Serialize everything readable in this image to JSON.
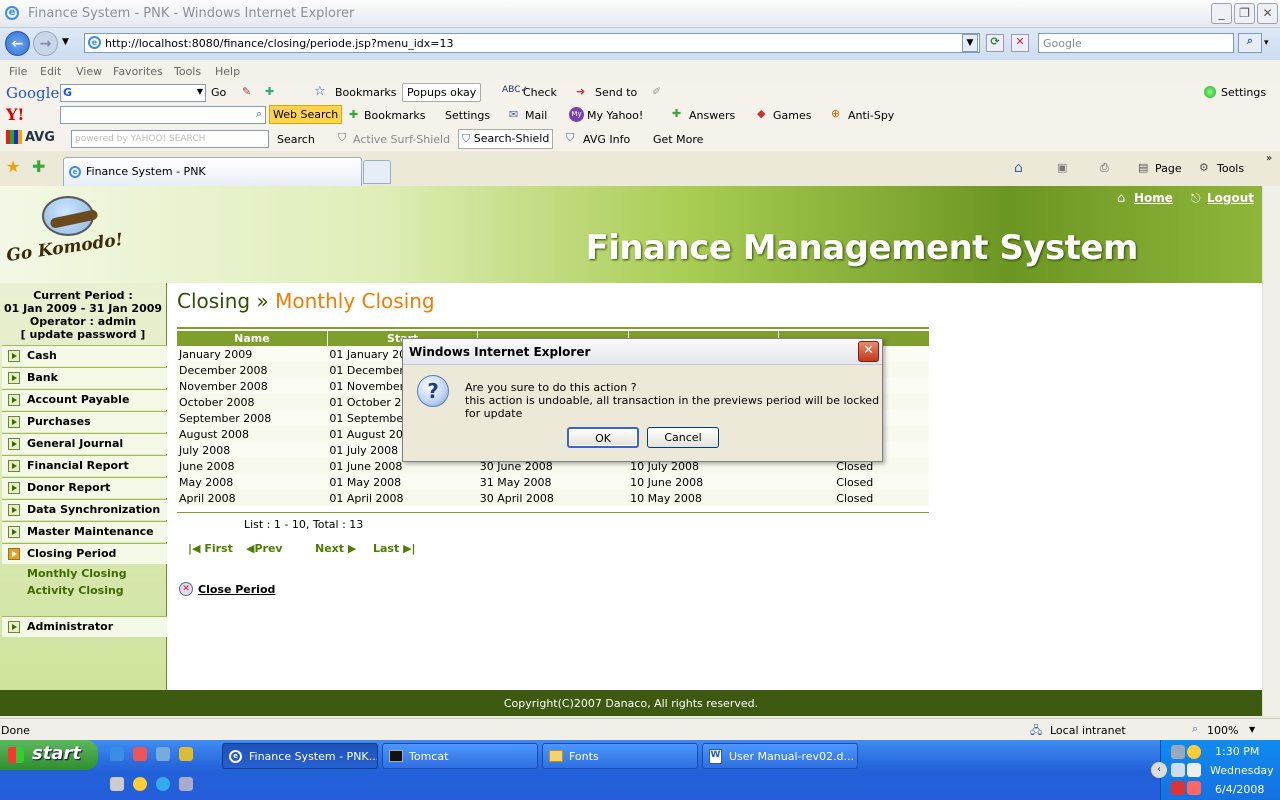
{
  "window": {
    "title": "Finance System - PNK - Windows Internet Explorer"
  },
  "address": {
    "url": "http://localhost:8080/finance/closing/periode.jsp?menu_idx=13",
    "search_placeholder": "Google"
  },
  "menu": [
    "File",
    "Edit",
    "View",
    "Favorites",
    "Tools",
    "Help"
  ],
  "google_bar": {
    "logo": "Google",
    "go": "Go",
    "bookmarks": "Bookmarks",
    "popups": "Popups okay",
    "check": "Check",
    "send_to": "Send to",
    "settings": "Settings"
  },
  "yahoo_bar": {
    "web_search": "Web Search",
    "bookmarks": "Bookmarks",
    "settings": "Settings",
    "mail": "Mail",
    "my_yahoo": "My Yahoo!",
    "answers": "Answers",
    "games": "Games",
    "anti_spy": "Anti-Spy"
  },
  "avg_bar": {
    "logo": "AVG",
    "placeholder": "powered by YAHOO! SEARCH",
    "search": "Search",
    "active_surf": "Active  Surf-Shield",
    "search_shield": "Search-Shield",
    "avg_info": "AVG Info",
    "get_more": "Get More"
  },
  "tab": {
    "label": "Finance System - PNK",
    "page": "Page",
    "tools": "Tools"
  },
  "banner": {
    "logo_text": "Go Komodo!",
    "title": "Finance Management System",
    "home": "Home",
    "logout": "Logout"
  },
  "sidebar": {
    "current_period_label": "Current Period :",
    "current_period": "01 Jan 2009 - 31 Jan 2009",
    "operator": "Operator : admin",
    "update_password": "[ update password ]",
    "items": [
      "Cash",
      "Bank",
      "Account Payable",
      "Purchases",
      "General Journal",
      "Financial Report",
      "Donor Report",
      "Data Synchronization",
      "Master Maintenance",
      "Closing Period"
    ],
    "subitems": [
      "Monthly Closing",
      "Activity Closing"
    ],
    "admin": "Administrator"
  },
  "content": {
    "heading": "Closing",
    "separator": "»",
    "subheading": "Monthly Closing",
    "columns": [
      "Name",
      "Start",
      "",
      ""
    ],
    "rows": [
      [
        "January 2009",
        "01 January 2009",
        "",
        "",
        ""
      ],
      [
        "December 2008",
        "01 December 2008",
        "",
        "",
        ""
      ],
      [
        "November 2008",
        "01 November 2008",
        "",
        "",
        ""
      ],
      [
        "October 2008",
        "01 October 2008",
        "",
        "",
        ""
      ],
      [
        "September 2008",
        "01 September 2008",
        "",
        "",
        ""
      ],
      [
        "August 2008",
        "01 August 2008",
        "",
        "",
        ""
      ],
      [
        "July 2008",
        "01 July 2008",
        "",
        "",
        ""
      ],
      [
        "June 2008",
        "01 June 2008",
        "30 June 2008",
        "10 July 2008",
        "Closed"
      ],
      [
        "May 2008",
        "01 May 2008",
        "31 May 2008",
        "10 June 2008",
        "Closed"
      ],
      [
        "April 2008",
        "01 April 2008",
        "30 April 2008",
        "10 May 2008",
        "Closed"
      ]
    ],
    "list_info": "List : 1 - 10, Total : 13",
    "pager": {
      "first": "First",
      "prev": "Prev",
      "next": "Next",
      "last": "Last"
    },
    "close_period": "Close Period"
  },
  "footer": "Copyright(C)2007 Danaco, All rights reserved.",
  "dialog": {
    "title": "Windows Internet Explorer",
    "line1": "Are you sure to do this action ?",
    "line2": "this action is undoable, all transaction in the previews period will be locked for update",
    "ok": "OK",
    "cancel": "Cancel"
  },
  "status": {
    "text": "Done",
    "zone": "Local intranet",
    "zoom": "100%"
  },
  "taskbar": {
    "start": "start",
    "tasks": [
      "Finance System - PNK...",
      "Tomcat",
      "Fonts",
      "User Manual-rev02.d..."
    ],
    "time": "1:30 PM",
    "day": "Wednesday",
    "date": "6/4/2008"
  }
}
